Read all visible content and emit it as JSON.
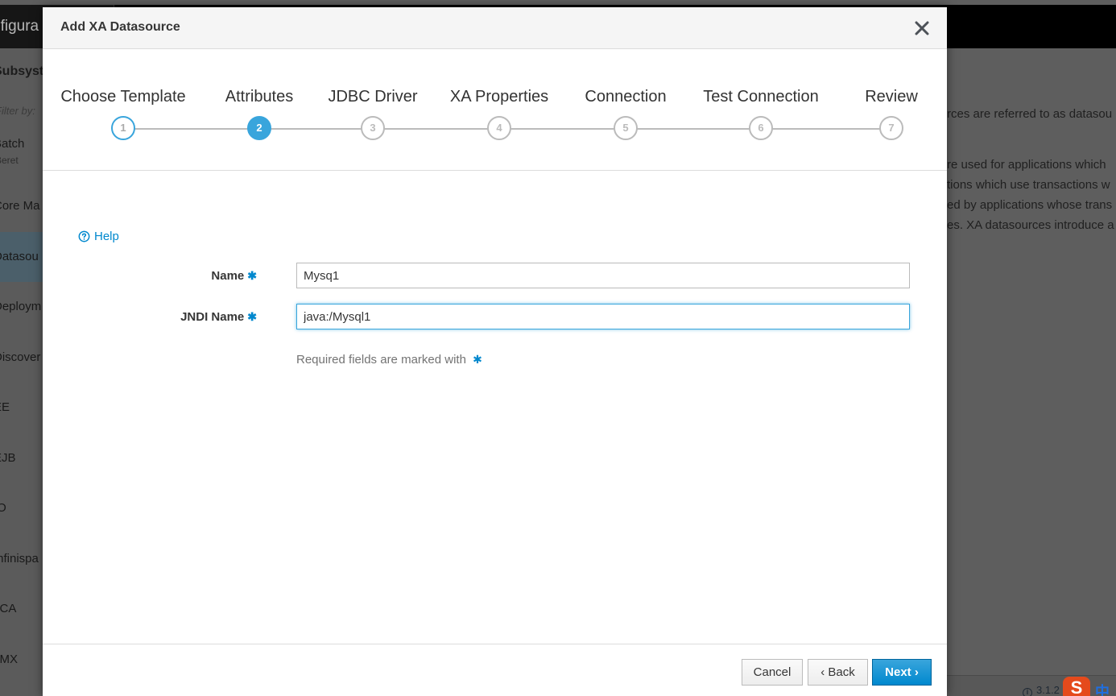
{
  "background": {
    "nav_title": "nfigura",
    "sidebar": {
      "title": "Subsyst",
      "filter": "Filter by: ",
      "items": [
        {
          "label": "Batch",
          "sub": "Beret"
        },
        {
          "label": "Core Ma",
          "sub": ""
        },
        {
          "label": "Datasou",
          "sub": ""
        },
        {
          "label": "Deploym",
          "sub": ""
        },
        {
          "label": "Discover",
          "sub": ""
        },
        {
          "label": "EE",
          "sub": ""
        },
        {
          "label": "EJB",
          "sub": ""
        },
        {
          "label": "IO",
          "sub": ""
        },
        {
          "label": "Infinispa",
          "sub": ""
        },
        {
          "label": "JCA",
          "sub": ""
        },
        {
          "label": "JMX",
          "sub": ""
        }
      ]
    },
    "content_lines": [
      "rces are referred to as datasou",
      "re used for applications which",
      "tions which use transactions w",
      "ed by applications whose trans",
      "es. XA datasources introduce a"
    ],
    "version": "3.1.2"
  },
  "modal": {
    "title": "Add XA Datasource",
    "steps": [
      {
        "label": "Choose Template",
        "num": "1",
        "state": "done"
      },
      {
        "label": "Attributes",
        "num": "2",
        "state": "current"
      },
      {
        "label": "JDBC Driver",
        "num": "3",
        "state": "todo"
      },
      {
        "label": "XA Properties",
        "num": "4",
        "state": "todo"
      },
      {
        "label": "Connection",
        "num": "5",
        "state": "todo"
      },
      {
        "label": "Test Connection",
        "num": "6",
        "state": "todo"
      },
      {
        "label": "Review",
        "num": "7",
        "state": "todo"
      }
    ],
    "help_label": "Help",
    "form": {
      "name_label": "Name",
      "name_value": "Mysq1",
      "jndi_label": "JNDI Name",
      "jndi_value": "java:/Mysql1",
      "required_asterisk": "✱",
      "hint": "Required fields are marked with"
    },
    "buttons": {
      "cancel": "Cancel",
      "back": "Back",
      "next": "Next",
      "back_chevron": "‹",
      "next_chevron": "›"
    }
  },
  "colors": {
    "accent": "#39a5dc",
    "link": "#0088ce",
    "primary": "#0088ce"
  }
}
